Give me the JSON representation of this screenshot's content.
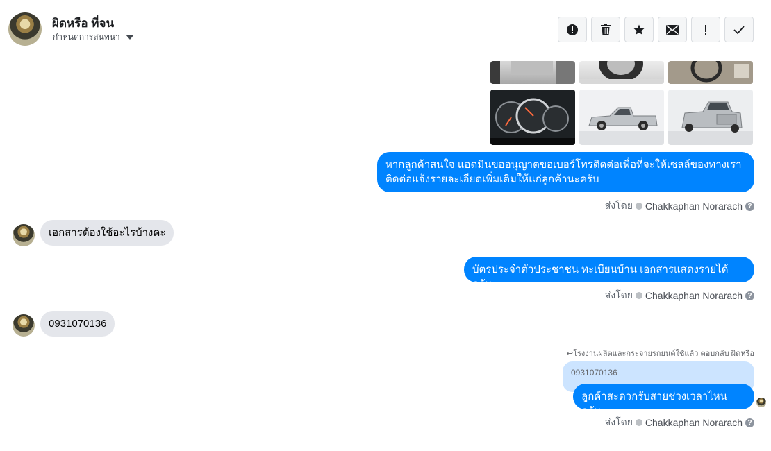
{
  "header": {
    "contact_name": "ผิดหรือ ที่จน",
    "assign_label": "กำหนดการสนทนา",
    "actions": [
      {
        "name": "mark-spam-button",
        "icon": "alert-circle-icon"
      },
      {
        "name": "delete-button",
        "icon": "trash-icon"
      },
      {
        "name": "star-button",
        "icon": "star-icon"
      },
      {
        "name": "mark-unread-button",
        "icon": "envelope-icon"
      },
      {
        "name": "follow-up-button",
        "icon": "exclamation-icon"
      },
      {
        "name": "mark-done-button",
        "icon": "checkmark-icon"
      }
    ]
  },
  "messages": [
    {
      "direction": "out",
      "text_line1": "หากลูกค้าสนใจ แอดมินขออนุญาตขอเบอร์โทรติดต่อเพื่อที่จะให้เซลล์ของทางเรา",
      "text_line2": "ติดต่อแจ้งรายละเอียดเพิ่มเติมให้แก่ลูกค้านะครับ"
    },
    {
      "direction": "in",
      "text": "เอกสารต้องใช้อะไรบ้างคะ"
    },
    {
      "direction": "out",
      "text": "บัตรประจำตัวประชาชน ทะเบียนบ้าน เอกสารแสดงรายได้ ครับ"
    },
    {
      "direction": "in",
      "text": "0931070136"
    },
    {
      "direction": "out",
      "text": "ลูกค้าสะดวกรับสายช่วงเวลาไหนครับ"
    }
  ],
  "sent_by": {
    "prefix": "ส่งโดย",
    "agent": "Chakkaphan Norarach"
  },
  "reply": {
    "note": "↩โรงงานผลิตและกระจายรถยนต์ใช้แล้ว ตอบกลับ ผิดหรือ",
    "quoted_text": "0931070136"
  },
  "colors": {
    "outgoing": "#0084ff",
    "incoming": "#e4e6eb",
    "reply_quote": "#cce4ff"
  }
}
